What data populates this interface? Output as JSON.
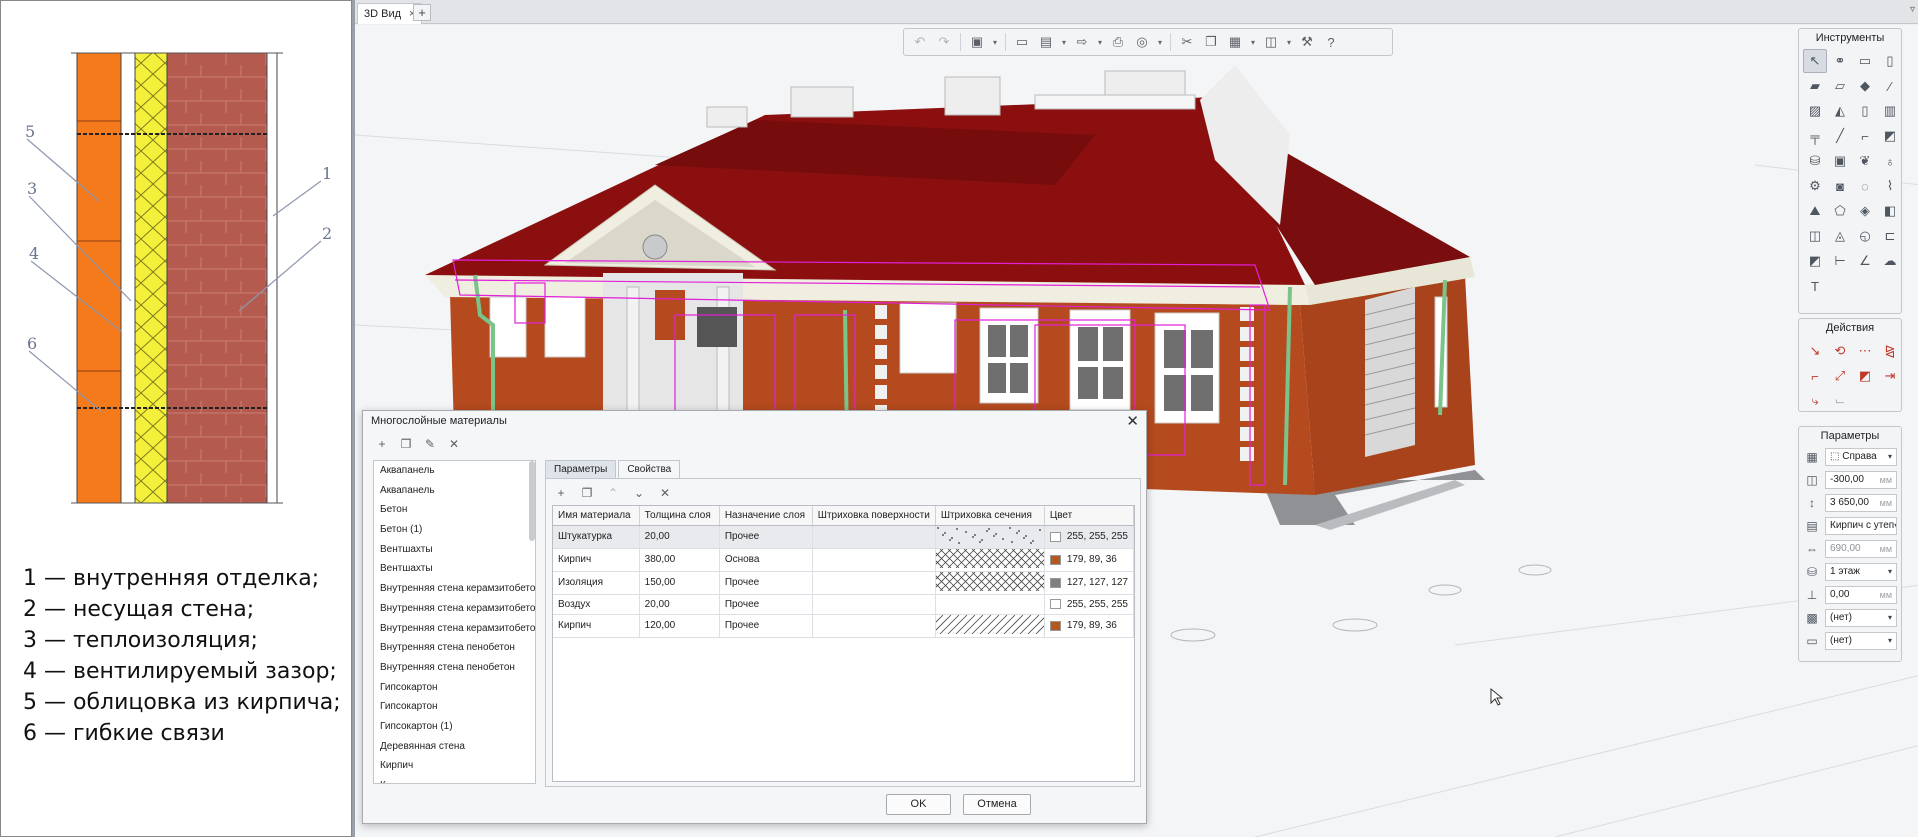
{
  "legend": [
    "1 — внутренняя отделка;",
    "2 — несущая стена;",
    "3 — теплоизоляция;",
    "4 — вентилируемый зазор;",
    "5 — облицовка из кирпича;",
    "6 — гибкие связи"
  ],
  "diagram_labels": [
    "5",
    "3",
    "4",
    "6",
    "1",
    "2"
  ],
  "tab": {
    "label": "3D Вид",
    "close": "×",
    "add": "+"
  },
  "tools_panel": {
    "title": "Инструменты"
  },
  "actions_panel": {
    "title": "Действия"
  },
  "params_panel": {
    "title": "Параметры",
    "rows": [
      {
        "value": "⬚ Справа",
        "unit": "",
        "caret": "▾"
      },
      {
        "value": "-300,00",
        "unit": "мм",
        "caret": ""
      },
      {
        "value": "3 650,00",
        "unit": "мм",
        "caret": ""
      },
      {
        "value": "Кирпич с утеп",
        "unit": "",
        "caret": "▾"
      },
      {
        "value": "690,00",
        "unit": "мм",
        "caret": ""
      },
      {
        "value": "1 этаж",
        "unit": "",
        "caret": "▾"
      },
      {
        "value": "0,00",
        "unit": "мм",
        "caret": ""
      },
      {
        "value": "(нет)",
        "unit": "",
        "caret": "▾"
      },
      {
        "value": "(нет)",
        "unit": "",
        "caret": "▾"
      }
    ]
  },
  "dialog": {
    "title": "Многослойные материалы",
    "close": "✕",
    "materials": [
      "Аквапанель",
      "Аквапанель",
      "Бетон",
      "Бетон (1)",
      "Вентшахты",
      "Вентшахты",
      "Внутренняя стена керамзитобетон",
      "Внутренняя стена керамзитобетон",
      "Внутренняя стена керамзитобетон",
      "Внутренняя стена пенобетон",
      "Внутренняя стена пенобетон",
      "Гипсокартон",
      "Гипсокартон",
      "Гипсокартон (1)",
      "Деревянная стена",
      "Кирпич",
      "К..."
    ],
    "tabs": [
      "Параметры",
      "Свойства"
    ],
    "columns": [
      "Имя материала",
      "Толщина слоя",
      "Назначение слоя",
      "Штриховка поверхности",
      "Штриховка сечения",
      "Цвет"
    ],
    "layers": [
      {
        "name": "Штукатурка",
        "thickness": "20,00",
        "purpose": "Прочее",
        "surface": "",
        "hatch": "dots",
        "color": "#ffffff",
        "color_text": "255, 255, 255"
      },
      {
        "name": "Кирпич",
        "thickness": "380,00",
        "purpose": "Основа",
        "surface": "",
        "hatch": "cross",
        "color": "#b3591f",
        "color_text": "179, 89, 36"
      },
      {
        "name": "Изоляция",
        "thickness": "150,00",
        "purpose": "Прочее",
        "surface": "",
        "hatch": "cross",
        "color": "#7f7f7f",
        "color_text": "127, 127, 127"
      },
      {
        "name": "Воздух",
        "thickness": "20,00",
        "purpose": "Прочее",
        "surface": "",
        "hatch": "none",
        "color": "#ffffff",
        "color_text": "255, 255, 255"
      },
      {
        "name": "Кирпич",
        "thickness": "120,00",
        "purpose": "Прочее",
        "surface": "",
        "hatch": "diag",
        "color": "#b3591f",
        "color_text": "179, 89, 36"
      }
    ],
    "ok": "OK",
    "cancel": "Отмена"
  },
  "colors": {
    "roof": "#8c0f0f",
    "brick": "#b54a1f",
    "insulation": "#f0ee3a",
    "orange": "#f57a1c",
    "highlight": "#e21fd9"
  }
}
